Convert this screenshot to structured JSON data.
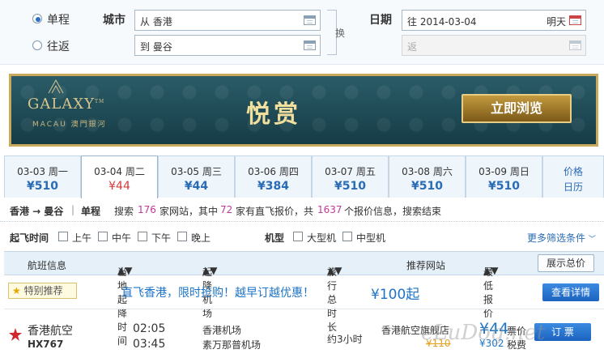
{
  "search": {
    "oneway_label": "单程",
    "roundtrip_label": "往返",
    "city_label": "城市",
    "date_label": "日期",
    "from_value": "从 香港",
    "to_value": "到 曼谷",
    "swap_label": "换",
    "depart_value": "往 2014-03-04",
    "depart_weekday": "明天",
    "return_placeholder": "返"
  },
  "banner": {
    "brand": "GALAXY",
    "brand_tm": "TM",
    "brand_sub": "MACAU 澳門銀河",
    "headline": "悦赏",
    "cta": "立即浏览",
    "accent_gold": "#c9a95b",
    "background": "#1f4a55"
  },
  "date_tabs": [
    {
      "date": "03-03 周一",
      "price": "¥510"
    },
    {
      "date": "03-04 周二",
      "price": "¥44"
    },
    {
      "date": "03-05 周三",
      "price": "¥44"
    },
    {
      "date": "03-06 周四",
      "price": "¥384"
    },
    {
      "date": "03-07 周五",
      "price": "¥510"
    },
    {
      "date": "03-08 周六",
      "price": "¥510"
    },
    {
      "date": "03-09 周日",
      "price": "¥510"
    },
    {
      "date": "价格",
      "price": "日历"
    }
  ],
  "route": {
    "route": "香港 → 曼谷",
    "sep": "|",
    "trip_type": "单程",
    "s1": "搜索",
    "sites": "176",
    "s2": "家网站，其中",
    "direct": "72",
    "s3": "家有直飞报价，共",
    "quotes": "1637",
    "s4": "个报价信息，搜索结束"
  },
  "filters": {
    "time_label": "起飞时间",
    "morning": "上午",
    "noon": "中午",
    "afternoon": "下午",
    "evening": "晚上",
    "type_label": "机型",
    "large": "大型机",
    "medium": "中型机",
    "more": "更多筛选条件"
  },
  "columns": {
    "flight": "航班信息",
    "time": "当地起降时间",
    "airport": "起降机场",
    "duration": "旅行总时长",
    "site": "推荐网站",
    "price": "最低报价",
    "show_total": "展示总价"
  },
  "promo": {
    "tag": "特别推荐",
    "text": "直飞香港，限时抢购！越早订越优惠！",
    "price": "¥100起",
    "button": "查看详情"
  },
  "flight": {
    "airline": "香港航空",
    "number": "HX767",
    "dep_time": "02:05",
    "arr_time": "03:45",
    "dep_airport": "香港机场",
    "arr_airport": "素万那普机场",
    "duration": "约3小时",
    "site": "香港航空旗舰店",
    "price": "¥44",
    "price_label": "票价",
    "tax_label": "税费",
    "old_price": "¥110",
    "tax": "¥302",
    "book": "订 票"
  },
  "watermark": "eLuDog.net"
}
